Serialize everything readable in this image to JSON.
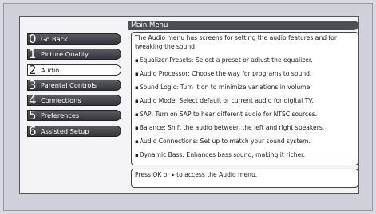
{
  "menu": {
    "title": "Main Menu"
  },
  "sidebar": {
    "items": [
      {
        "num": "0",
        "label": "Go Back"
      },
      {
        "num": "1",
        "label": "Picture Quality"
      },
      {
        "num": "2",
        "label": "Audio"
      },
      {
        "num": "3",
        "label": "Parental Controls"
      },
      {
        "num": "4",
        "label": "Connections"
      },
      {
        "num": "5",
        "label": "Preferences"
      },
      {
        "num": "6",
        "label": "Assisted Setup"
      }
    ],
    "selected_index": 2
  },
  "content": {
    "intro": "The Audio menu has screens for setting the audio features and for tweaking the sound:",
    "bullets": [
      "Equalizer Presets: Select a preset or adjust the equalizer.",
      "Audio Processor: Choose the way for programs to sound.",
      "Sound Logic: Turn it on to minimize variations in volume.",
      "Audio Mode: Select default or current audio for digital TV.",
      "SAP: Turn on SAP to hear different audio for NTSC sources.",
      "Balance: Shift the audio between the left and right speakers.",
      "Audio Connections: Set up to match your sound system.",
      "Dynamic Bass: Enhances bass sound, making it richer."
    ]
  },
  "footer": {
    "hint": "Press OK or ▸ to access the Audio menu."
  },
  "colors": {
    "panel_bg": "#f4f4f6",
    "nav_bg": "#3e3e45",
    "nav_selected_bg": "#ffffff",
    "title_bar": "#4e4e55"
  }
}
